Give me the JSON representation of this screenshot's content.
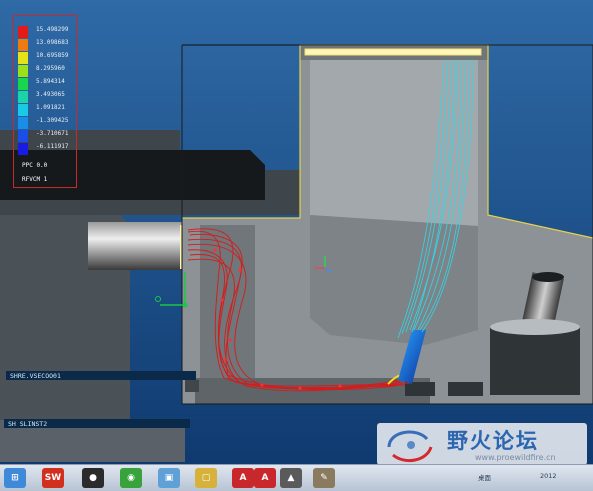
{
  "legend": {
    "values": [
      "15.498299",
      "13.098683",
      "10.695859",
      "8.295960",
      "5.894314",
      "3.493065",
      "1.091821",
      "-1.309425",
      "-3.710671",
      "-6.111917"
    ],
    "colors": [
      "#e21a1a",
      "#ee7a10",
      "#e6e21a",
      "#9ae11a",
      "#1ad64a",
      "#1ad6a6",
      "#1ac9e6",
      "#1a8ee6",
      "#1a4ee6",
      "#1a1ae6"
    ],
    "extra_labels": [
      "PPC 0.0",
      "RFVCM 1"
    ]
  },
  "labels": {
    "streamline_set_1": "SHRE.VSECOO01",
    "streamline_set_2": "SH SLINST2"
  },
  "watermark": {
    "site_name": "野火论坛",
    "url": "www.proewildfire.cn"
  },
  "taskbar": {
    "icons": [
      {
        "name": "windows-start-icon",
        "color": "#3f8ad8",
        "glyph": "⊞"
      },
      {
        "name": "solidworks-icon",
        "color": "#d1301f",
        "glyph": "SW"
      },
      {
        "name": "qq-penguin-icon",
        "color": "#2b2b2b",
        "glyph": "●"
      },
      {
        "name": "green-app-icon",
        "color": "#38a33c",
        "glyph": "◉"
      },
      {
        "name": "window-app-icon",
        "color": "#5fa0d6",
        "glyph": "▣"
      },
      {
        "name": "yellow-window-icon",
        "color": "#d6b23a",
        "glyph": "▢"
      },
      {
        "name": "pdf-icon",
        "color": "#c8282c",
        "glyph": "A"
      },
      {
        "name": "pdf-icon-2",
        "color": "#c8282c",
        "glyph": "A"
      },
      {
        "name": "photo-app-icon",
        "color": "#5a5a5a",
        "glyph": "▲"
      },
      {
        "name": "tool-app-icon",
        "color": "#8a7a60",
        "glyph": "✎"
      }
    ],
    "tray_text": "桌面",
    "clock_text": "2012"
  }
}
